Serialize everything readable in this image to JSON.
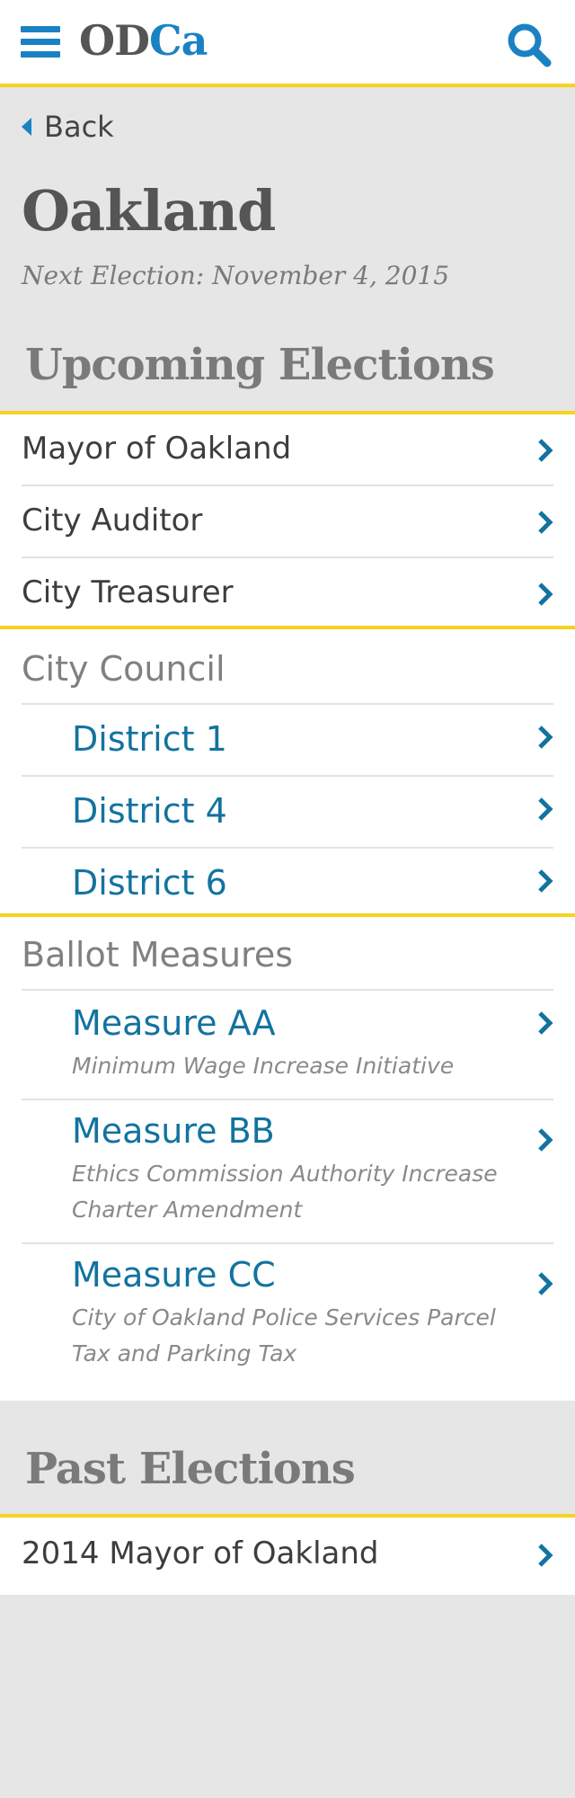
{
  "header": {
    "logo_od": "OD",
    "logo_ca": "Ca"
  },
  "back": {
    "label": "Back"
  },
  "city": {
    "name": "Oakland",
    "next_election": "Next Election: November 4, 2015"
  },
  "upcoming": {
    "heading": "Upcoming Elections",
    "offices": [
      {
        "label": "Mayor of Oakland"
      },
      {
        "label": "City Auditor"
      },
      {
        "label": "City Treasurer"
      }
    ],
    "council": {
      "label": "City Council",
      "districts": [
        {
          "label": "District 1"
        },
        {
          "label": "District 4"
        },
        {
          "label": "District 6"
        }
      ]
    },
    "measures": {
      "label": "Ballot Measures",
      "items": [
        {
          "label": "Measure AA",
          "description": "Minimum Wage Increase Initiative"
        },
        {
          "label": "Measure BB",
          "description": "Ethics Commission Authority Increase Charter Amendment"
        },
        {
          "label": "Measure CC",
          "description": "City of Oakland Police Services Parcel Tax and Parking Tax"
        }
      ]
    }
  },
  "past": {
    "heading": "Past Elections",
    "items": [
      {
        "label": "2014 Mayor of Oakland"
      }
    ]
  },
  "colors": {
    "accent_blue": "#1a82c3",
    "link_blue": "#12739f",
    "divider_yellow": "#f5d321",
    "background_gray": "#e6e6e6"
  },
  "icons": {
    "menu": "hamburger-icon",
    "search": "search-icon",
    "back": "caret-left-icon",
    "chevron": "chevron-right-icon"
  }
}
